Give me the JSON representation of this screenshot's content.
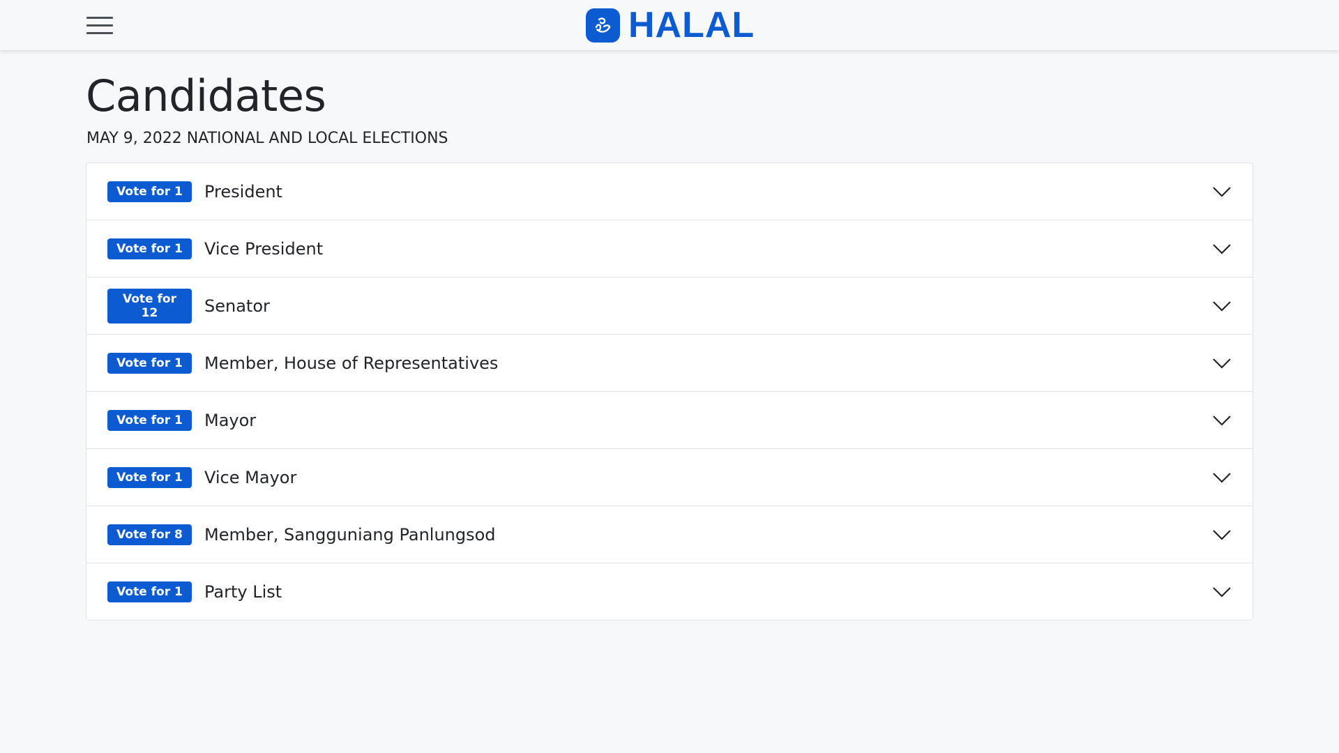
{
  "header": {
    "logo_text": "HALAL",
    "brand_color": "#0d5bd1"
  },
  "page": {
    "title": "Candidates",
    "subtitle": "MAY 9, 2022 NATIONAL AND LOCAL ELECTIONS"
  },
  "positions": [
    {
      "badge": "Vote for 1",
      "label": "President"
    },
    {
      "badge": "Vote for 1",
      "label": "Vice President"
    },
    {
      "badge": "Vote for 12",
      "label": "Senator"
    },
    {
      "badge": "Vote for 1",
      "label": "Member, House of Representatives"
    },
    {
      "badge": "Vote for 1",
      "label": "Mayor"
    },
    {
      "badge": "Vote for 1",
      "label": "Vice Mayor"
    },
    {
      "badge": "Vote for 8",
      "label": "Member, Sangguniang Panlungsod"
    },
    {
      "badge": "Vote for 1",
      "label": "Party List"
    }
  ],
  "icons": {
    "menu": "hamburger-menu-icon",
    "logo": "halal-logo-icon",
    "expand": "chevron-down-icon"
  }
}
